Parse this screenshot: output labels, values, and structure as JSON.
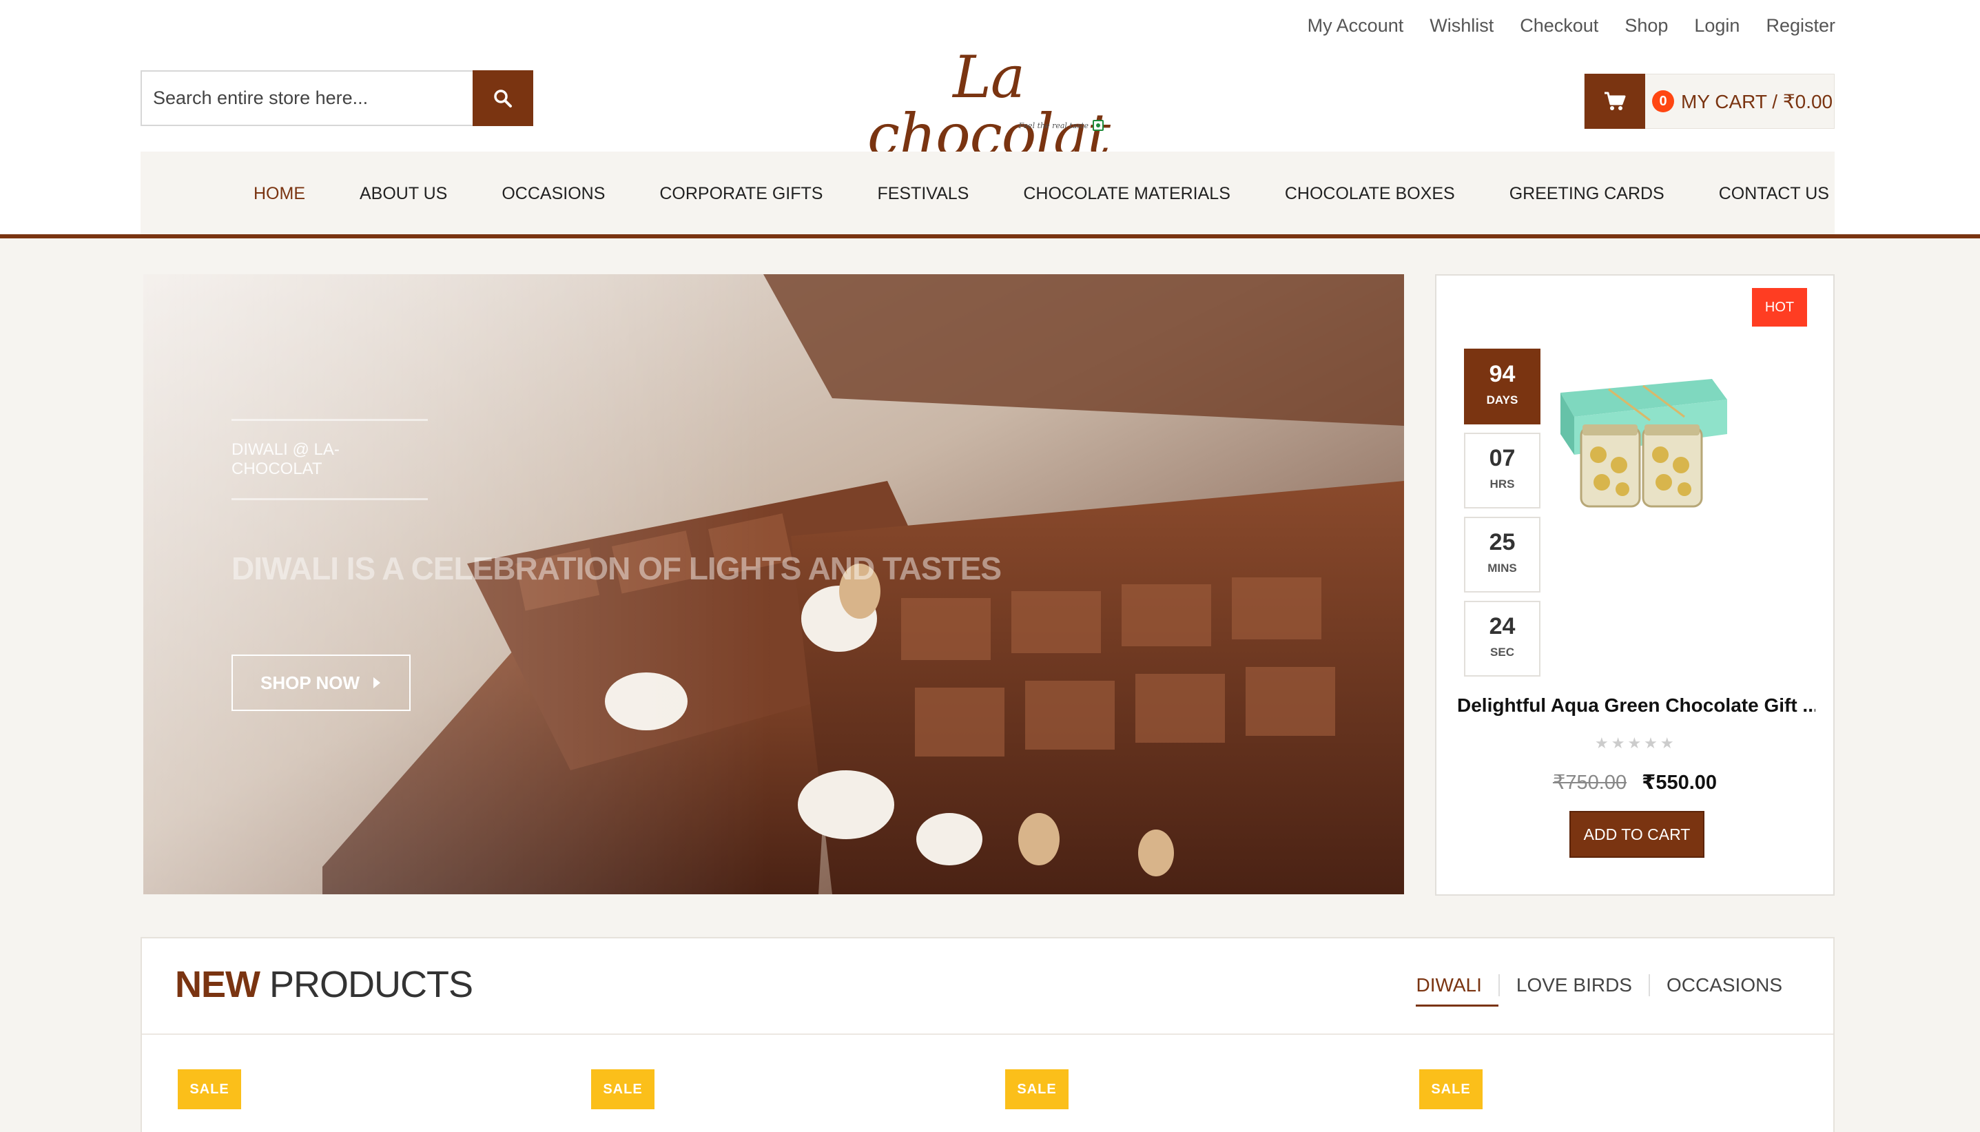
{
  "top_links": [
    "My Account",
    "Wishlist",
    "Checkout",
    "Shop",
    "Login",
    "Register"
  ],
  "search": {
    "placeholder": "Search entire store here..."
  },
  "logo": {
    "text": "La chocolat",
    "tagline": "Feel the real taste"
  },
  "cart": {
    "count": "0",
    "label": "MY CART / ₹0.00"
  },
  "nav": {
    "items": [
      "HOME",
      "ABOUT US",
      "OCCASIONS",
      "CORPORATE GIFTS",
      "FESTIVALS",
      "CHOCOLATE MATERIALS",
      "CHOCOLATE BOXES",
      "GREETING CARDS",
      "CONTACT US"
    ],
    "active": "HOME"
  },
  "hero": {
    "kicker": "DIWALI @ LA-CHOCOLAT",
    "title": "DIWALI IS A CELEBRATION OF LIGHTS AND TASTES",
    "button": "SHOP NOW"
  },
  "deal": {
    "badge": "HOT",
    "countdown": [
      {
        "value": "94",
        "unit": "DAYS"
      },
      {
        "value": "07",
        "unit": "HRS"
      },
      {
        "value": "25",
        "unit": "MINS"
      },
      {
        "value": "24",
        "unit": "SEC"
      }
    ],
    "product_name": "Delightful Aqua Green Chocolate Gift ...",
    "rating": 0,
    "old_price": "₹750.00",
    "price": "₹550.00",
    "button": "ADD TO CART"
  },
  "new_products": {
    "title_bold": "NEW",
    "title_rest": " PRODUCTS",
    "tabs": [
      "DIWALI",
      "LOVE BIRDS",
      "OCCASIONS"
    ],
    "active_tab": "DIWALI",
    "sale_badges": [
      "SALE",
      "SALE",
      "SALE",
      "SALE"
    ]
  },
  "colors": {
    "brand": "#7a3411",
    "hot": "#ff3d22",
    "sale": "#fbbf1a",
    "cart_count": "#ff4612"
  }
}
